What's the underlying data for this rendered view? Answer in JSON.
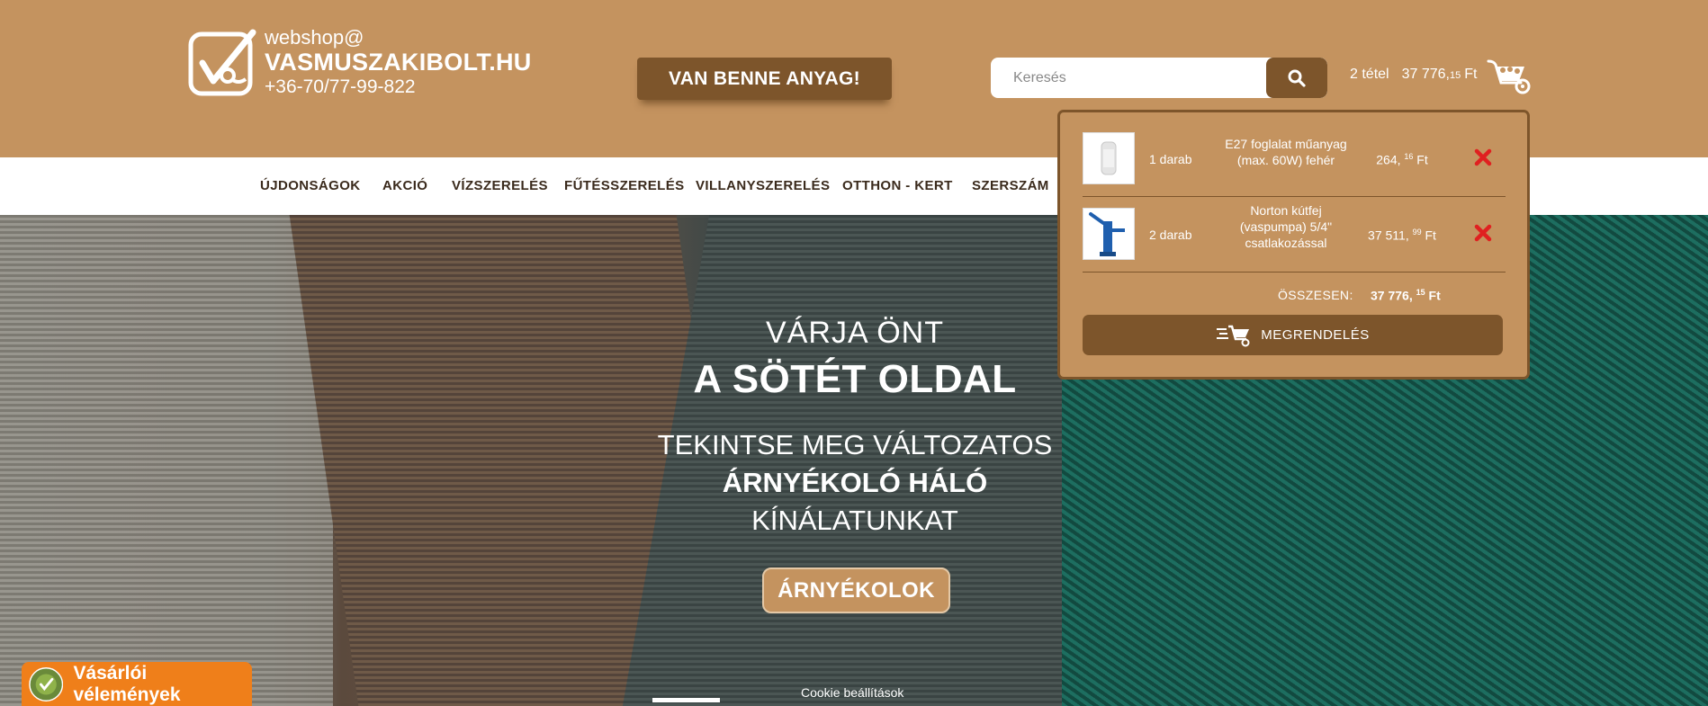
{
  "brand": {
    "small": "webshop@",
    "name": "VASMUSZAKIBOLT.HU",
    "phone": "+36-70/77-99-822"
  },
  "promo": {
    "label": "VAN BENNE ANYAG!"
  },
  "search": {
    "placeholder": "Keresés",
    "icon": "search-icon"
  },
  "cart": {
    "count": "2 tétel",
    "total_main": "37 776,",
    "total_cents": "15",
    "currency": "Ft",
    "icon": "wheelbarrow-cart-icon"
  },
  "nav": {
    "items": [
      "ÚJDONSÁGOK",
      "AKCIÓ",
      "VÍZSZERELÉS",
      "FŰTÉSSZERELÉS",
      "VILLANYSZERELÉS",
      "OTTHON - KERT",
      "SZERSZÁM"
    ]
  },
  "hero": {
    "line1": "VÁRJA ÖNT",
    "line2": "A SÖTÉT OLDAL",
    "line3": "TEKINTSE MEG VÁLTOZATOS",
    "line4": "ÁRNYÉKOLÓ HÁLÓ",
    "line5": "KÍNÁLATUNKAT",
    "button": "ÁRNYÉKOLOK"
  },
  "cookie": "Cookie beállítások",
  "reviews": {
    "label": "Vásárlói vélemények"
  },
  "cart_dropdown": {
    "items": [
      {
        "qty": "1 darab",
        "name": "E27 foglalat műanyag (max. 60W) fehér",
        "price_main": "264,",
        "price_cents": "16",
        "currency": "Ft"
      },
      {
        "qty": "2 darab",
        "name": "Norton kútfej (vaspumpa) 5/4\" csatlakozással",
        "price_main": "37 511,",
        "price_cents": "99",
        "currency": "Ft"
      }
    ],
    "total_label": "ÖSSZESEN:",
    "total_main": "37 776,",
    "total_cents": "15",
    "total_currency": "Ft",
    "order_button": "MEGRENDELÉS"
  },
  "colors": {
    "header_bg": "#c4935f",
    "accent_dark": "#7d552b",
    "reviews_orange": "#ef7f1a",
    "remove_red": "#e02020"
  }
}
